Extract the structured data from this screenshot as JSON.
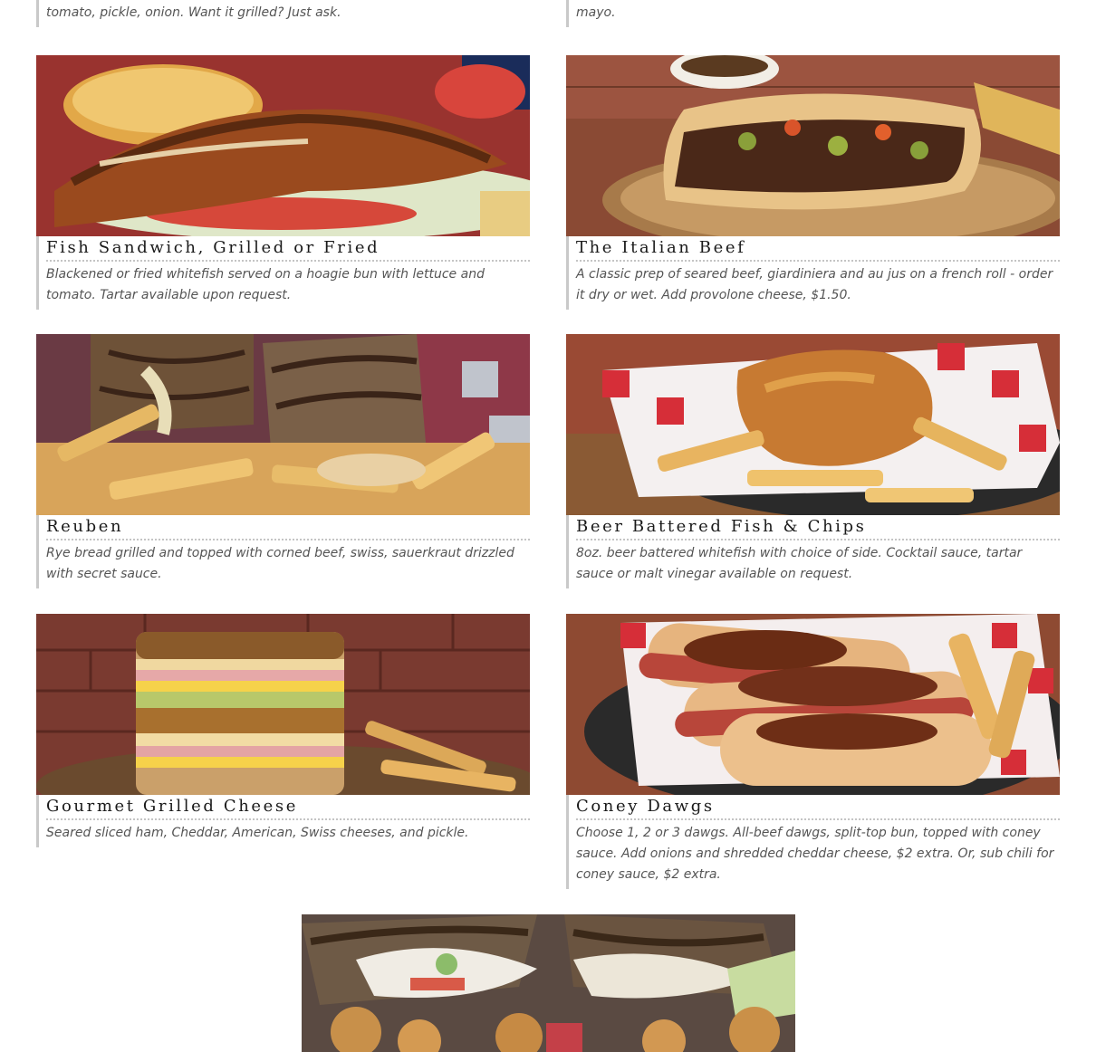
{
  "top_partial": {
    "left_desc": "tomato, pickle, onion. Want it grilled? Just ask.",
    "right_desc": "mayo."
  },
  "menu_items": [
    {
      "title": "Fish Sandwich, Grilled or Fried",
      "description": "Blackened or fried whitefish served on a hoagie bun with lettuce and tomato. Tartar available upon request."
    },
    {
      "title": "The Italian Beef",
      "description": "A classic prep of seared beef, giardiniera and au jus on a french roll - order it dry or wet. Add provolone cheese, $1.50."
    },
    {
      "title": "Reuben",
      "description": "Rye bread grilled and topped with corned beef, swiss, sauerkraut drizzled with secret sauce."
    },
    {
      "title": "Beer Battered Fish & Chips",
      "description": "8oz. beer battered whitefish with choice of side. Cocktail sauce, tartar sauce or malt vinegar available on request."
    },
    {
      "title": "Gourmet Grilled Cheese",
      "description": "Seared sliced ham, Cheddar, American, Swiss cheeses, and pickle."
    },
    {
      "title": "Coney Dawgs",
      "description": "Choose 1, 2 or 3 dawgs. All-beef dawgs, split-top bun, topped with coney sauce. Add onions and shredded cheddar cheese, $2 extra. Or, sub chili for coney sauce, $2 extra."
    }
  ]
}
